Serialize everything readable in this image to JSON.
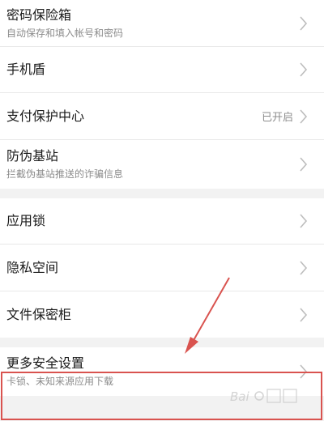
{
  "group1": [
    {
      "title": "密码保险箱",
      "subtitle": "自动保存和填入帐号和密码"
    },
    {
      "title": "手机盾"
    },
    {
      "title": "支付保护中心",
      "status": "已开启"
    },
    {
      "title": "防伪基站",
      "subtitle": "拦截伪基站推送的诈骗信息"
    }
  ],
  "group2": [
    {
      "title": "应用锁"
    },
    {
      "title": "隐私空间"
    },
    {
      "title": "文件保密柜"
    }
  ],
  "group3": [
    {
      "title": "更多安全设置",
      "subtitle": "卡锁、未知来源应用下载"
    }
  ],
  "annotation": {
    "color": "#d9534f"
  },
  "icons": {
    "chevron": "chevron-right-icon",
    "watermark": "baidu-jingyan-watermark"
  }
}
